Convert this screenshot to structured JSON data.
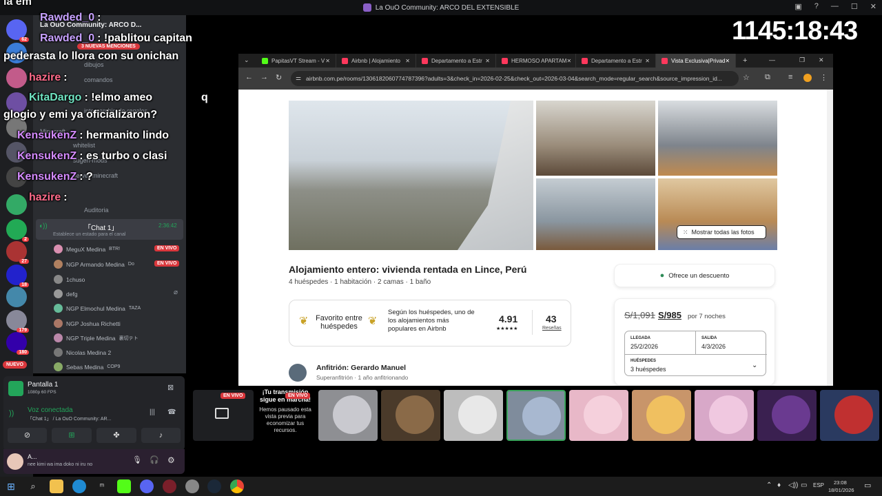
{
  "window": {
    "title": "La OuO Community: ARCO DEL EXTENSIBLE"
  },
  "server": {
    "name": "La OuO Community: ARCO D...",
    "mentions_badge": "3 NUEVAS MENCIONES",
    "badges": [
      "62",
      "2",
      "27",
      "18",
      "179",
      "180"
    ],
    "new_label": "NUEVO",
    "channels": [
      "dibujos",
      "comandos",
      "intercambio-de-regalos",
      "Minecraft",
      "whitelist",
      "sugeri-mods",
      "server-minecraft"
    ],
    "voice_section": "Auditoria",
    "active_voice": "「Chat 1」",
    "active_voice_time": "2:36:42",
    "status_hint": "Establece un estado para el canal",
    "voice_users": [
      {
        "name": "MeguX Medina",
        "tag": "BTR!",
        "live": "EN VIVO"
      },
      {
        "name": "NGP Armando Medina",
        "tag": "Do",
        "live": "EN VIVO"
      },
      {
        "name": "1chuso",
        "tag": "",
        "live": ""
      },
      {
        "name": "defg",
        "tag": "",
        "live": ""
      },
      {
        "name": "NGP Elmochul Medina",
        "tag": "TAZA",
        "live": ""
      },
      {
        "name": "NGP Joshua Richetti",
        "tag": "",
        "live": ""
      },
      {
        "name": "NGP Triple Medina",
        "tag": "裏切テト",
        "live": ""
      },
      {
        "name": "Nicolas Medina 2",
        "tag": "",
        "live": ""
      },
      {
        "name": "Sebas Medina",
        "tag": "COP9",
        "live": ""
      }
    ]
  },
  "chat": [
    {
      "user": "",
      "text": "la em"
    },
    {
      "user": "Rawded_0",
      "text": ":"
    },
    {
      "user": "Rawded_0",
      "text": ": !pablitou capitan"
    },
    {
      "user": "",
      "text": "pederasta lo llora con su onichan"
    },
    {
      "user": "hazire",
      "text": ":"
    },
    {
      "user": "KitaDargo",
      "text": ": !elmo ameo"
    },
    {
      "user": "",
      "text": "q"
    },
    {
      "user": "",
      "text": "glogio y emi ya oficializaron?"
    },
    {
      "user": "KensukenZ",
      "text": ": hermanito lindo"
    },
    {
      "user": "KensukenZ",
      "text": ": es turbo o clasi"
    },
    {
      "user": "KensukenZ",
      "text": ": ?"
    },
    {
      "user": "hazire",
      "text": ":"
    }
  ],
  "screen_panel": {
    "title": "Pantalla 1",
    "subtitle": "1080p 60 FPS",
    "voice_status": "Voz conectada",
    "voice_channel": "「Chat 1」 / La OuO Community: AR...",
    "user_name": "A...",
    "user_status": "nee kimi wa ima doko ni iru no"
  },
  "timer": "1145:18:43",
  "browser": {
    "tabs": [
      {
        "label": "PapitasVT Stream - V",
        "color": "#53fc18"
      },
      {
        "label": "Airbnb | Alojamiento",
        "color": "#ff385c"
      },
      {
        "label": "Departamento a Estr",
        "color": "#ff385c"
      },
      {
        "label": "HERMOSO APARTAM",
        "color": "#ff385c"
      },
      {
        "label": "Departamento a Estr",
        "color": "#ff385c"
      },
      {
        "label": "Vista Exclusiva|Privad",
        "color": "#ff385c"
      }
    ],
    "url": "airbnb.com.pe/rooms/1306182060774787396?adults=3&check_in=2026-02-25&check_out=2026-03-04&search_mode=regular_search&source_impression_id..."
  },
  "listing": {
    "show_all": "Mostrar todas las fotos",
    "title": "Alojamiento entero: vivienda rentada en Lince, Perú",
    "details": "4 huéspedes · 1 habitación · 2 camas · 1 baño",
    "favorite_label": "Favorito entre huéspedes",
    "favorite_desc_1": "Según los huéspedes, uno de",
    "favorite_desc_2": "los alojamientos más",
    "favorite_desc_3": "populares en Airbnb",
    "rating": "4.91",
    "stars": "★★★★★",
    "reviews_count": "43",
    "reviews_label": "Reseñas",
    "host": "Anfitrión: Gerardo Manuel",
    "host_sub": "Superanfitrión · 1 año anfitrionando",
    "discount": "Ofrece un descuento",
    "old_price": "S/1,091",
    "price": "S/985",
    "price_suffix": "por 7 noches",
    "checkin_label": "LLEGADA",
    "checkin": "25/2/2026",
    "checkout_label": "SALIDA",
    "checkout": "4/3/2026",
    "guests_label": "HUÉSPEDES",
    "guests": "3 huéspedes"
  },
  "stream_strip": {
    "live": "EN VIVO",
    "notice_title": "¡Tu transmisión sigue en marcha!",
    "notice_body": "Hemos pausado esta vista previa para economizar tus recursos."
  },
  "taskbar": {
    "lang": "ESP",
    "time": "23:08",
    "date": "18/01/2026"
  }
}
